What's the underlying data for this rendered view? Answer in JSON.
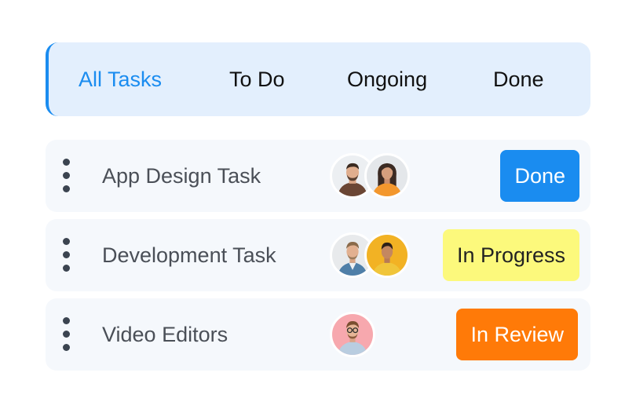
{
  "tabs": [
    {
      "label": "All Tasks",
      "active": true
    },
    {
      "label": "To Do",
      "active": false
    },
    {
      "label": "Ongoing",
      "active": false
    },
    {
      "label": "Done",
      "active": false
    }
  ],
  "tasks": [
    {
      "title": "App Design Task",
      "status": "Done",
      "status_color": "#1a8cf0",
      "assignees": [
        "man-brown-sweater-avatar",
        "woman-orange-top-avatar"
      ]
    },
    {
      "title": "Development Task",
      "status": "In Progress",
      "status_color": "#fcf97c",
      "assignees": [
        "man-denim-shirt-avatar",
        "man-yellow-background-avatar"
      ]
    },
    {
      "title": "Video Editors",
      "status": "In Review",
      "status_color": "#ff7a08",
      "assignees": [
        "man-glasses-pink-background-avatar"
      ]
    }
  ],
  "colors": {
    "accent": "#1a8cf0",
    "tabbar_bg": "#e3effd",
    "row_bg": "#f5f8fc"
  }
}
